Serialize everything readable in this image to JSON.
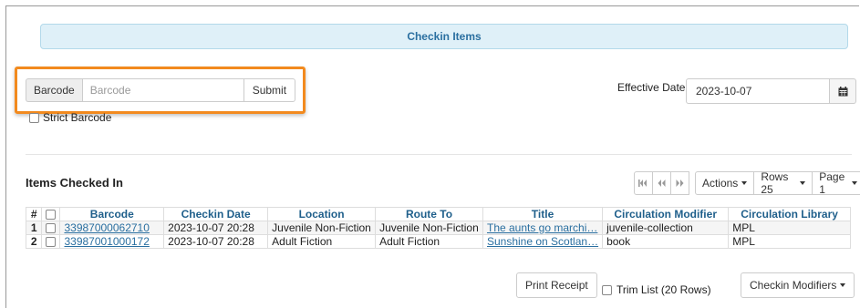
{
  "header": {
    "title": "Checkin Items"
  },
  "form": {
    "barcode_label": "Barcode",
    "barcode_placeholder": "Barcode",
    "barcode_value": "",
    "submit_label": "Submit",
    "strict_barcode_label": "Strict Barcode",
    "strict_barcode_checked": false,
    "effective_date_label": "Effective Date",
    "effective_date_value": "2023-10-07",
    "calendar_icon": "calendar-icon"
  },
  "section": {
    "title": "Items Checked In"
  },
  "pager": {
    "first_icon": "first-page-icon",
    "prev_icon": "prev-page-icon",
    "next_icon": "next-page-icon",
    "actions_label": "Actions",
    "rows_label": "Rows 25",
    "page_label": "Page 1"
  },
  "table": {
    "columns": [
      "#",
      "",
      "Barcode",
      "Checkin Date",
      "Location",
      "Route To",
      "Title",
      "Circulation Modifier",
      "Circulation Library"
    ],
    "rows": [
      {
        "num": "1",
        "barcode": "33987000062710",
        "checkin_date": "2023-10-07 20:28",
        "location": "Juvenile Non-Fiction",
        "route_to": "Juvenile Non-Fiction",
        "title": "The aunts go marchi…",
        "circ_modifier": "juvenile-collection",
        "circ_library": "MPL"
      },
      {
        "num": "2",
        "barcode": "33987001000172",
        "checkin_date": "2023-10-07 20:28",
        "location": "Adult Fiction",
        "route_to": "Adult Fiction",
        "title": "Sunshine on Scotlan…",
        "circ_modifier": "book",
        "circ_library": "MPL"
      }
    ]
  },
  "footer": {
    "print_receipt_label": "Print Receipt",
    "trim_list_label": "Trim List (20 Rows)",
    "trim_list_checked": false,
    "checkin_modifiers_label": "Checkin Modifiers"
  },
  "colors": {
    "accent": "#2a6fa0",
    "header_bg": "#dff0f8",
    "highlight": "#f28a1e"
  }
}
